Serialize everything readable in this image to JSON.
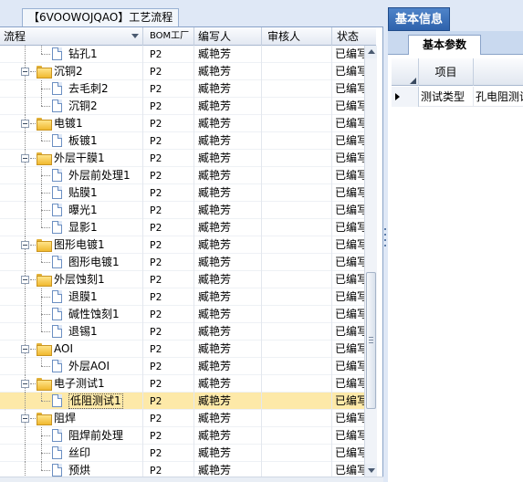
{
  "left_panel": {
    "tab_label": "【6VOOWOJQAO】工艺流程",
    "columns": {
      "process": "流程",
      "bom_factory": "BOM工厂",
      "writer": "编写人",
      "reviewer": "审核人",
      "status": "状态"
    },
    "rows": [
      {
        "label": "钻孔1",
        "level": 2,
        "type": "doc",
        "bom": "P2",
        "writer": "臧艳芳",
        "reviewer": "",
        "status": "已编写"
      },
      {
        "label": "沉铜2",
        "level": 1,
        "type": "folder",
        "bom": "P2",
        "writer": "臧艳芳",
        "reviewer": "",
        "status": "已编写"
      },
      {
        "label": "去毛刺2",
        "level": 2,
        "type": "doc",
        "bom": "P2",
        "writer": "臧艳芳",
        "reviewer": "",
        "status": "已编写"
      },
      {
        "label": "沉铜2",
        "level": 2,
        "type": "doc",
        "bom": "P2",
        "writer": "臧艳芳",
        "reviewer": "",
        "status": "已编写"
      },
      {
        "label": "电镀1",
        "level": 1,
        "type": "folder",
        "bom": "P2",
        "writer": "臧艳芳",
        "reviewer": "",
        "status": "已编写"
      },
      {
        "label": "板镀1",
        "level": 2,
        "type": "doc",
        "bom": "P2",
        "writer": "臧艳芳",
        "reviewer": "",
        "status": "已编写"
      },
      {
        "label": "外层干膜1",
        "level": 1,
        "type": "folder",
        "bom": "P2",
        "writer": "臧艳芳",
        "reviewer": "",
        "status": "已编写"
      },
      {
        "label": "外层前处理1",
        "level": 2,
        "type": "doc",
        "bom": "P2",
        "writer": "臧艳芳",
        "reviewer": "",
        "status": "已编写"
      },
      {
        "label": "贴膜1",
        "level": 2,
        "type": "doc",
        "bom": "P2",
        "writer": "臧艳芳",
        "reviewer": "",
        "status": "已编写"
      },
      {
        "label": "曝光1",
        "level": 2,
        "type": "doc",
        "bom": "P2",
        "writer": "臧艳芳",
        "reviewer": "",
        "status": "已编写"
      },
      {
        "label": "显影1",
        "level": 2,
        "type": "doc",
        "bom": "P2",
        "writer": "臧艳芳",
        "reviewer": "",
        "status": "已编写"
      },
      {
        "label": "图形电镀1",
        "level": 1,
        "type": "folder",
        "bom": "P2",
        "writer": "臧艳芳",
        "reviewer": "",
        "status": "已编写"
      },
      {
        "label": "图形电镀1",
        "level": 2,
        "type": "doc",
        "bom": "P2",
        "writer": "臧艳芳",
        "reviewer": "",
        "status": "已编写"
      },
      {
        "label": "外层蚀刻1",
        "level": 1,
        "type": "folder",
        "bom": "P2",
        "writer": "臧艳芳",
        "reviewer": "",
        "status": "已编写"
      },
      {
        "label": "退膜1",
        "level": 2,
        "type": "doc",
        "bom": "P2",
        "writer": "臧艳芳",
        "reviewer": "",
        "status": "已编写"
      },
      {
        "label": "碱性蚀刻1",
        "level": 2,
        "type": "doc",
        "bom": "P2",
        "writer": "臧艳芳",
        "reviewer": "",
        "status": "已编写"
      },
      {
        "label": "退锡1",
        "level": 2,
        "type": "doc",
        "bom": "P2",
        "writer": "臧艳芳",
        "reviewer": "",
        "status": "已编写"
      },
      {
        "label": "AOI",
        "level": 1,
        "type": "folder",
        "bom": "P2",
        "writer": "臧艳芳",
        "reviewer": "",
        "status": "已编写"
      },
      {
        "label": "外层AOI",
        "level": 2,
        "type": "doc",
        "bom": "P2",
        "writer": "臧艳芳",
        "reviewer": "",
        "status": "已编写"
      },
      {
        "label": "电子测试1",
        "level": 1,
        "type": "folder",
        "bom": "P2",
        "writer": "臧艳芳",
        "reviewer": "",
        "status": "已编写"
      },
      {
        "label": "低阻测试1",
        "level": 2,
        "type": "doc",
        "bom": "P2",
        "writer": "臧艳芳",
        "reviewer": "",
        "status": "已编写",
        "selected": true
      },
      {
        "label": "阻焊",
        "level": 1,
        "type": "folder",
        "bom": "P2",
        "writer": "臧艳芳",
        "reviewer": "",
        "status": "已编写"
      },
      {
        "label": "阻焊前处理",
        "level": 2,
        "type": "doc",
        "bom": "P2",
        "writer": "臧艳芳",
        "reviewer": "",
        "status": "已编写"
      },
      {
        "label": "丝印",
        "level": 2,
        "type": "doc",
        "bom": "P2",
        "writer": "臧艳芳",
        "reviewer": "",
        "status": "已编写"
      },
      {
        "label": "预烘",
        "level": 2,
        "type": "doc",
        "bom": "P2",
        "writer": "臧艳芳",
        "reviewer": "",
        "status": "已编写"
      }
    ]
  },
  "right_panel": {
    "tab_label": "基本信息",
    "subtab_label": "基本参数",
    "grid": {
      "header": "项目",
      "row_key": "测试类型",
      "row_value": "孔电阻测试"
    }
  },
  "colors": {
    "selection": "#fde9a8",
    "tab_blue": "#2e62ac",
    "panel_bg": "#dfe8f6",
    "border": "#8aa3c8"
  },
  "icons": {
    "folder": "folder-icon",
    "document": "document-icon",
    "collapse": "minus-expander-icon"
  }
}
